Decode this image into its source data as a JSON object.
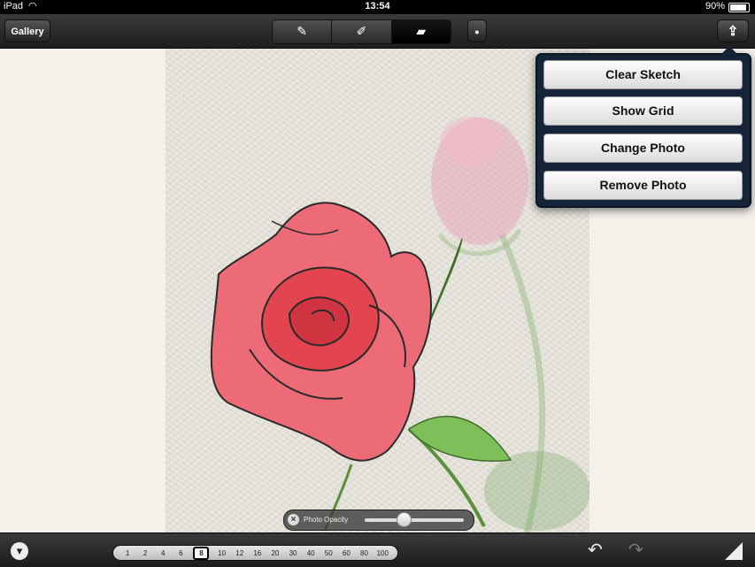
{
  "status_bar": {
    "device": "iPad",
    "time": "13:54",
    "battery": "90%",
    "battery_level": 0.9
  },
  "toolbar": {
    "gallery_label": "Gallery",
    "tools": [
      {
        "icon": "pencil-icon",
        "glyph": "✎",
        "active": false
      },
      {
        "icon": "marker-icon",
        "glyph": "✐",
        "active": false
      },
      {
        "icon": "eraser-icon",
        "glyph": "▰",
        "active": true
      }
    ],
    "brush_glyph": "●",
    "share_glyph": "⇪"
  },
  "popover_menu": {
    "items": [
      "Clear Sketch",
      "Show Grid",
      "Change Photo",
      "Remove Photo"
    ]
  },
  "photo_opacity": {
    "label": "Photo Opacity",
    "value": 0.4
  },
  "brush_sizes": {
    "sizes": [
      "1",
      "2",
      "4",
      "6",
      "8",
      "10",
      "12",
      "16",
      "20",
      "30",
      "40",
      "50",
      "60",
      "80",
      "100"
    ],
    "selected": "8"
  },
  "bottom_bar": {
    "collapse_glyph": "▾",
    "undo_glyph": "↶",
    "redo_glyph": "↷"
  },
  "colors": {
    "rose": "#e55a66",
    "leaf": "#6fa34c",
    "popover": "#16243a"
  }
}
